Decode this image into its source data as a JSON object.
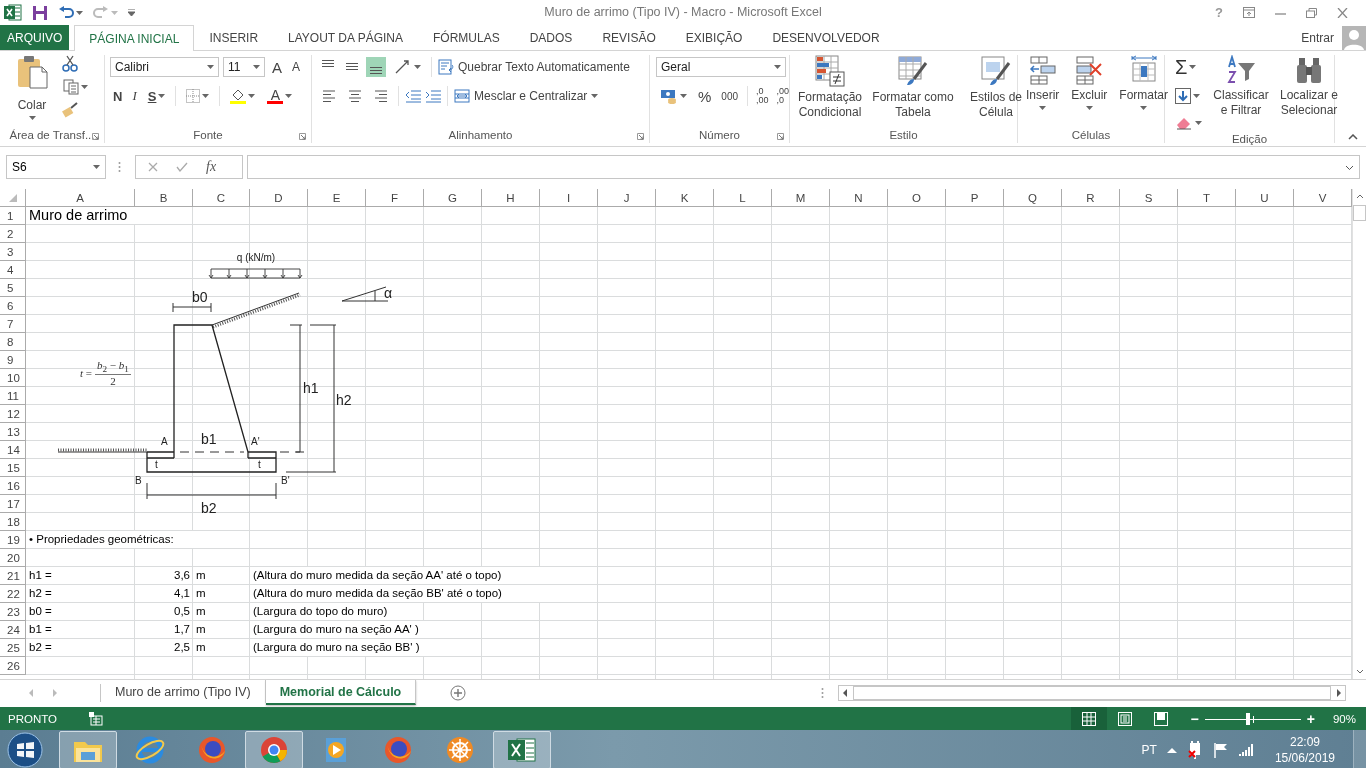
{
  "title_bar": {
    "title": "Muro de arrimo (Tipo IV) - Macro - Microsoft Excel",
    "help": "?"
  },
  "tabs": [
    {
      "label": "ARQUIVO",
      "kind": "file",
      "selected": false
    },
    {
      "label": "PÁGINA INICIAL",
      "kind": "tab",
      "selected": true
    },
    {
      "label": "INSERIR",
      "kind": "tab",
      "selected": false
    },
    {
      "label": "LAYOUT DA PÁGINA",
      "kind": "tab",
      "selected": false
    },
    {
      "label": "FÓRMULAS",
      "kind": "tab",
      "selected": false
    },
    {
      "label": "DADOS",
      "kind": "tab",
      "selected": false
    },
    {
      "label": "REVISÃO",
      "kind": "tab",
      "selected": false
    },
    {
      "label": "EXIBIÇÃO",
      "kind": "tab",
      "selected": false
    },
    {
      "label": "DESENVOLVEDOR",
      "kind": "tab",
      "selected": false
    }
  ],
  "account": {
    "label": "Entrar"
  },
  "ribbon": {
    "groups": [
      {
        "kind": "clipboard",
        "label": "Área de Transf...",
        "paste": "Colar"
      },
      {
        "kind": "font",
        "label": "Fonte",
        "font": "Calibri",
        "size": "11",
        "grow": "A",
        "shrink": "A",
        "styles": [
          "N",
          "I",
          "S"
        ],
        "font_color": "A"
      },
      {
        "kind": "alignment",
        "label": "Alinhamento",
        "vertical_align": [
          {
            "selected": false
          },
          {
            "selected": false
          },
          {
            "selected": true
          }
        ],
        "horizontal_align": [
          {
            "selected": false
          },
          {
            "selected": false
          },
          {
            "selected": false
          }
        ],
        "wrap": "Quebrar Texto Automaticamente",
        "merge": "Mesclar e Centralizar"
      },
      {
        "kind": "number",
        "label": "Número",
        "format": "Geral",
        "percent": "%",
        "thousands": "000",
        "decimals": [
          {
            "top": ",0",
            "bottom": ",00"
          },
          {
            "top": ",00",
            "bottom": ",0"
          }
        ]
      },
      {
        "kind": "styles",
        "label": "Estilo",
        "buttons": [
          "Formatação Condicional",
          "Formatar como Tabela",
          "Estilos de Célula"
        ]
      },
      {
        "kind": "cells",
        "label": "Células",
        "buttons": [
          "Inserir",
          "Excluir",
          "Formatar"
        ]
      },
      {
        "kind": "editing",
        "label": "Edição",
        "sum": "Σ",
        "buttons": [
          "Classificar e Filtrar",
          "Localizar e Selecionar"
        ]
      }
    ]
  },
  "formula_bar": {
    "name_box": "S6",
    "function_label": "fx"
  },
  "sheet": {
    "columns": [
      "A",
      "B",
      "C",
      "D",
      "E",
      "F",
      "G",
      "H",
      "I",
      "J",
      "K",
      "L",
      "M",
      "N",
      "O",
      "P",
      "Q",
      "R",
      "S",
      "T",
      "U",
      "V"
    ],
    "rows": [
      {
        "label": "1",
        "kind": "heading",
        "cells": [
          "Muro de arrimo"
        ]
      },
      {
        "label": "2",
        "kind": "blank"
      },
      {
        "label": "3",
        "kind": "blank"
      },
      {
        "label": "4",
        "kind": "blank"
      },
      {
        "label": "5",
        "kind": "blank"
      },
      {
        "label": "6",
        "kind": "blank"
      },
      {
        "label": "7",
        "kind": "blank"
      },
      {
        "label": "8",
        "kind": "blank"
      },
      {
        "label": "9",
        "kind": "blank"
      },
      {
        "label": "10",
        "kind": "blank"
      },
      {
        "label": "11",
        "kind": "blank"
      },
      {
        "label": "12",
        "kind": "blank"
      },
      {
        "label": "13",
        "kind": "blank"
      },
      {
        "label": "14",
        "kind": "blank"
      },
      {
        "label": "15",
        "kind": "blank"
      },
      {
        "label": "16",
        "kind": "blank"
      },
      {
        "label": "17",
        "kind": "blank"
      },
      {
        "label": "18",
        "kind": "blank"
      },
      {
        "label": "19",
        "kind": "note",
        "cells": [
          "• Propriedades geométricas:"
        ]
      },
      {
        "label": "20",
        "kind": "blank"
      },
      {
        "label": "21",
        "kind": "property",
        "cells": [
          "h1 =",
          "3,6",
          "m",
          "(Altura do muro medida da seção AA' até o topo)"
        ]
      },
      {
        "label": "22",
        "kind": "property",
        "cells": [
          "h2 =",
          "4,1",
          "m",
          "(Altura do muro medida da seção BB' até o topo)"
        ]
      },
      {
        "label": "23",
        "kind": "property",
        "cells": [
          "b0 =",
          "0,5",
          "m",
          "(Largura do topo do muro)"
        ]
      },
      {
        "label": "24",
        "kind": "property",
        "cells": [
          "b1 =",
          "1,7",
          "m",
          "(Largura do muro na seção AA' )"
        ]
      },
      {
        "label": "25",
        "kind": "property",
        "cells": [
          "b2 =",
          "2,5",
          "m",
          "(Largura do muro na seção BB' )"
        ]
      },
      {
        "label": "26",
        "kind": "blank"
      }
    ],
    "diagram": {
      "load_label": "q (kN/m)",
      "labels": [
        "b0",
        "α",
        "h1",
        "h2",
        "A",
        "b1",
        "A'",
        "t",
        "t",
        "B",
        "B'",
        "b2"
      ],
      "formula": {
        "lhs": "*t* =",
        "numerator": "*b*$_{2}$ − *b*$_{1}$",
        "denominator": "2"
      }
    }
  },
  "sheet_tabs": [
    {
      "label": "Muro de arrimo (Tipo IV)",
      "selected": false
    },
    {
      "label": "Memorial de Cálculo",
      "selected": true
    }
  ],
  "status_bar": {
    "mode": "PRONTO",
    "views": [
      {
        "kind": "normal",
        "selected": true
      },
      {
        "kind": "page-layout",
        "selected": false
      },
      {
        "kind": "page-break",
        "selected": false
      }
    ],
    "zoom": {
      "minus": "−",
      "plus": "+",
      "level": 0.45,
      "reading": "90%"
    }
  },
  "taskbar": {
    "apps": [
      {
        "kind": "explorer",
        "running": true
      },
      {
        "kind": "ie",
        "running": false
      },
      {
        "kind": "firefox",
        "running": false
      },
      {
        "kind": "chrome",
        "running": true
      },
      {
        "kind": "media",
        "running": false
      },
      {
        "kind": "firefox",
        "running": false
      },
      {
        "kind": "wheel",
        "running": false
      },
      {
        "kind": "excel",
        "running": true
      }
    ],
    "language": "PT",
    "time": "22:09",
    "date": "15/06/2019"
  }
}
